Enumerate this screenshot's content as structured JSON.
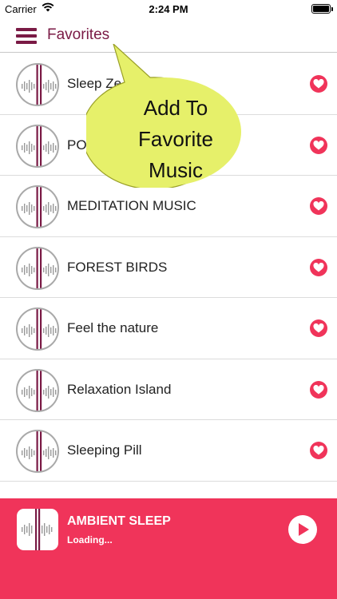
{
  "status_bar": {
    "carrier": "Carrier",
    "time": "2:24 PM",
    "wifi_icon": "wifi-icon",
    "battery_icon": "battery-icon"
  },
  "nav": {
    "title": "Favorites",
    "menu_icon": "hamburger-menu-icon"
  },
  "tracks": [
    {
      "title": "Sleep Ze",
      "favorite": true
    },
    {
      "title": "POS",
      "favorite": true
    },
    {
      "title": "MEDITATION MUSIC",
      "favorite": true
    },
    {
      "title": "FOREST BIRDS",
      "favorite": true
    },
    {
      "title": "Feel the nature",
      "favorite": true
    },
    {
      "title": "Relaxation Island",
      "favorite": true
    },
    {
      "title": "Sleeping Pill",
      "favorite": true
    }
  ],
  "callout": {
    "line1": "Add To",
    "line2": "Favorite",
    "line3": "Music"
  },
  "player": {
    "title": "AMBIENT SLEEP",
    "status": "Loading...",
    "play_icon": "play-icon"
  },
  "colors": {
    "accent": "#f0345a",
    "brand": "#7a1a45",
    "callout": "#e6f06a"
  }
}
